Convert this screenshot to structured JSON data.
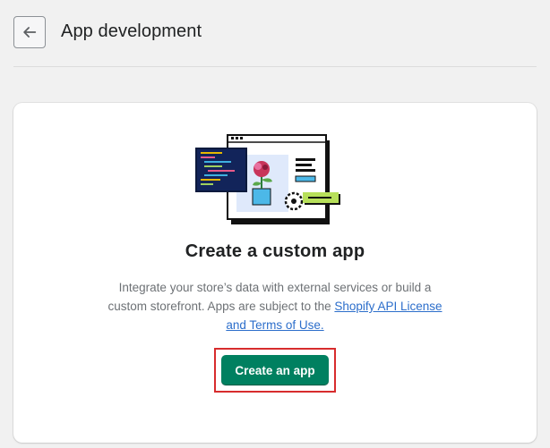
{
  "header": {
    "title": "App development",
    "back_icon": "arrow-left-icon"
  },
  "card": {
    "illustration_icon": "custom-app-illustration",
    "title": "Create a custom app",
    "description_lead": "Integrate your store’s data with external services or build a custom storefront. Apps are subject to the ",
    "link_label": "Shopify API License and Terms of Use.",
    "button_label": "Create an app"
  },
  "colors": {
    "primary_button": "#008060",
    "link": "#2c6ecb",
    "highlight": "#d72c2d"
  }
}
